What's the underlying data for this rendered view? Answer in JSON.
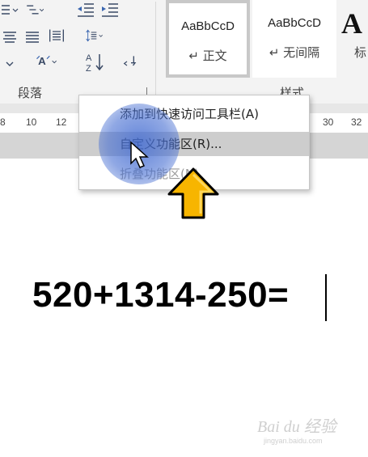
{
  "ribbon": {
    "paragraph_group_label": "段落",
    "styles_group_label": "样式",
    "styles": [
      {
        "sample": "AaBbCcD",
        "name": "↵ 正文",
        "selected": true
      },
      {
        "sample": "AaBbCcD",
        "name": "↵ 无间隔",
        "selected": false
      }
    ],
    "large_style_sample": "A",
    "large_style_name": "标"
  },
  "ruler": {
    "left_numbers": [
      "8",
      "10",
      "12"
    ],
    "right_numbers": [
      "30",
      "32"
    ]
  },
  "context_menu": {
    "items": [
      {
        "label": "添加到快速访问工具栏(A)",
        "state": "normal"
      },
      {
        "label": "自定义功能区(R)...",
        "state": "hover"
      },
      {
        "label": "折叠功能区(N)",
        "state": "disabled"
      }
    ]
  },
  "document": {
    "text": "520+1314-250="
  },
  "watermark": {
    "text": "Bai du 经验",
    "subtext": "jingyan.baidu.com"
  },
  "colors": {
    "ribbon_bg": "#f3f3f3",
    "highlight": "#466ed2",
    "arrow_fill": "#f7b500"
  }
}
